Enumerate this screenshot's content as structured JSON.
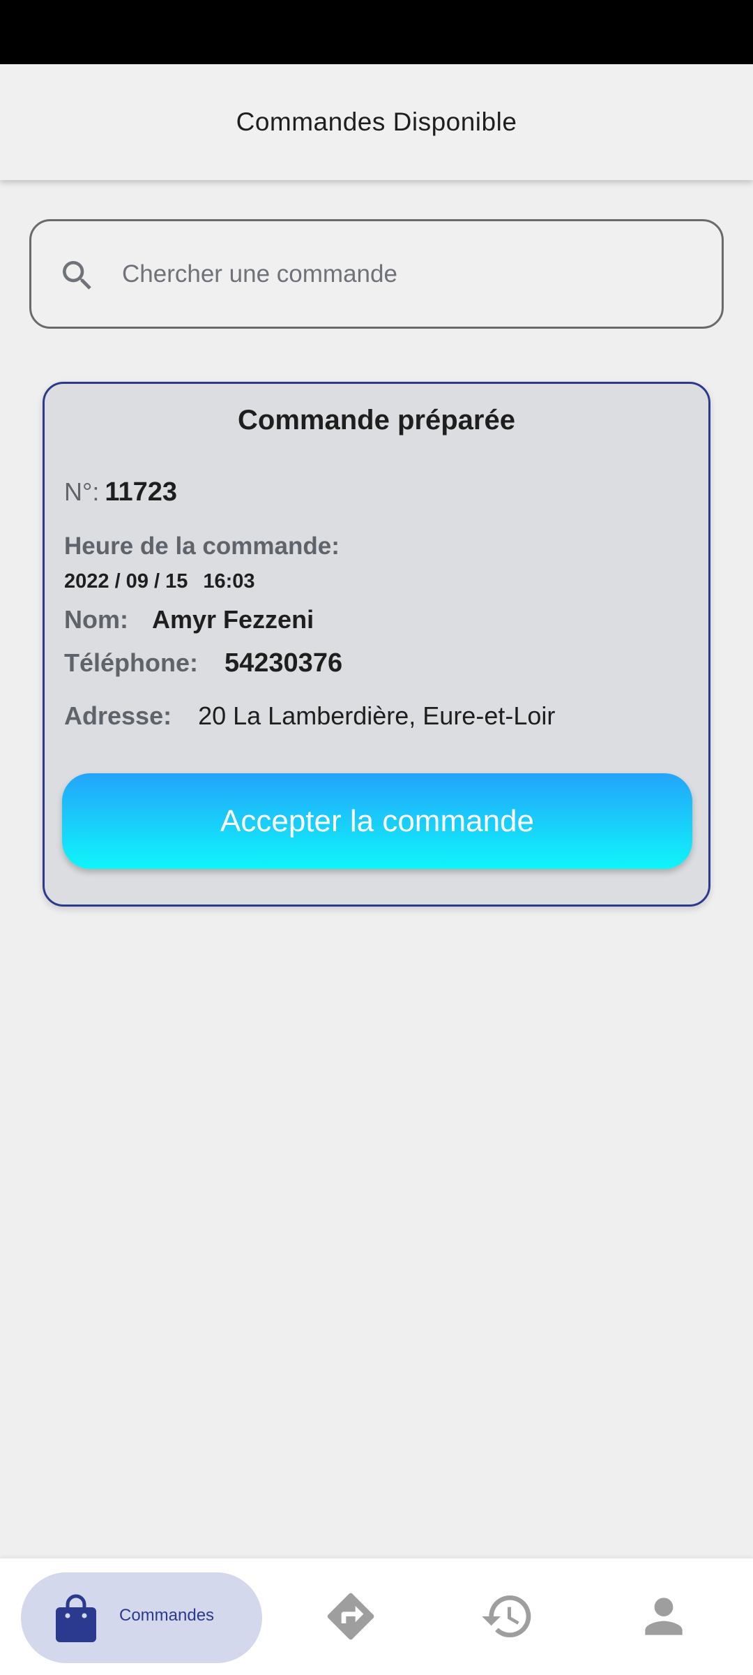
{
  "header": {
    "title": "Commandes Disponible"
  },
  "search": {
    "placeholder": "Chercher une commande",
    "icon": "search-icon"
  },
  "order_card": {
    "title": "Commande préparée",
    "number_label": "N°:",
    "number_value": "11723",
    "time_label": "Heure de la commande:",
    "date_value": "2022 / 09 / 15",
    "time_value": "16:03",
    "name_label": "Nom:",
    "name_value": "Amyr Fezzeni",
    "phone_label": "Téléphone:",
    "phone_value": "54230376",
    "address_label": "Adresse:",
    "address_value": "20 La Lamberdière, Eure-et-Loir",
    "accept_button_label": "Accepter la commande"
  },
  "bottom_nav": {
    "items": [
      {
        "label": "Commandes",
        "icon": "shopping-bag-icon",
        "active": true
      },
      {
        "label": "",
        "icon": "directions-icon",
        "active": false
      },
      {
        "label": "",
        "icon": "history-icon",
        "active": false
      },
      {
        "label": "",
        "icon": "person-icon",
        "active": false
      }
    ]
  },
  "colors": {
    "accent": "#2b3a8e",
    "button_top": "#23a4fb",
    "button_bottom": "#0ff5f9",
    "card_background": "#dcdde0",
    "nav_active_background": "#d4d8ec",
    "nav_inactive_icon": "#9e9e9e"
  }
}
